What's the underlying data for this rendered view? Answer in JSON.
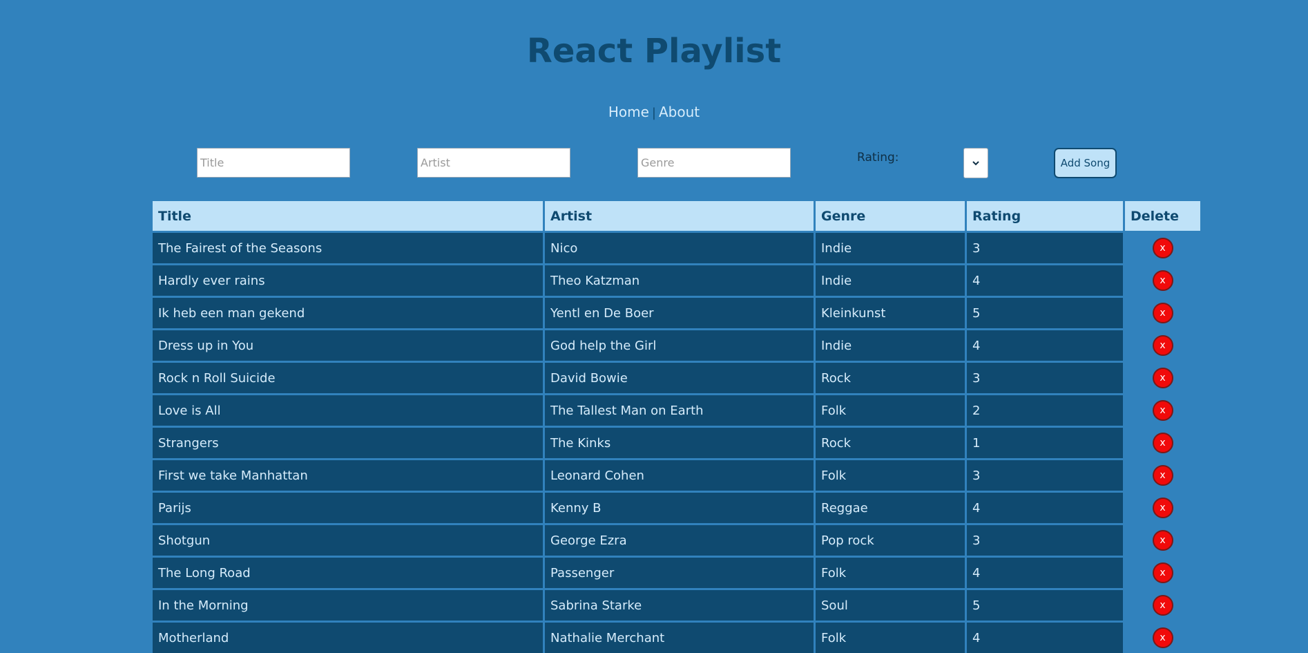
{
  "header": {
    "title": "React Playlist"
  },
  "nav": {
    "items": [
      {
        "label": "Home"
      },
      {
        "label": "About"
      }
    ],
    "separator": "|"
  },
  "form": {
    "title_placeholder": "Title",
    "artist_placeholder": "Artist",
    "genre_placeholder": "Genre",
    "rating_label": "Rating:",
    "rating_selected": "",
    "add_button_label": "Add Song"
  },
  "table": {
    "columns": [
      "Title",
      "Artist",
      "Genre",
      "Rating",
      "Delete"
    ],
    "delete_label": "x",
    "rows": [
      {
        "title": "The Fairest of the Seasons",
        "artist": "Nico",
        "genre": "Indie",
        "rating": "3"
      },
      {
        "title": "Hardly ever rains",
        "artist": "Theo Katzman",
        "genre": "Indie",
        "rating": "4"
      },
      {
        "title": "Ik heb een man gekend",
        "artist": "Yentl en De Boer",
        "genre": "Kleinkunst",
        "rating": "5"
      },
      {
        "title": "Dress up in You",
        "artist": "God help the Girl",
        "genre": "Indie",
        "rating": "4"
      },
      {
        "title": "Rock n Roll Suicide",
        "artist": "David Bowie",
        "genre": "Rock",
        "rating": "3"
      },
      {
        "title": "Love is All",
        "artist": "The Tallest Man on Earth",
        "genre": "Folk",
        "rating": "2"
      },
      {
        "title": "Strangers",
        "artist": "The Kinks",
        "genre": "Rock",
        "rating": "1"
      },
      {
        "title": "First we take Manhattan",
        "artist": "Leonard Cohen",
        "genre": "Folk",
        "rating": "3"
      },
      {
        "title": "Parijs",
        "artist": "Kenny B",
        "genre": "Reggae",
        "rating": "4"
      },
      {
        "title": "Shotgun",
        "artist": "George Ezra",
        "genre": "Pop rock",
        "rating": "3"
      },
      {
        "title": "The Long Road",
        "artist": "Passenger",
        "genre": "Folk",
        "rating": "4"
      },
      {
        "title": "In the Morning",
        "artist": "Sabrina Starke",
        "genre": "Soul",
        "rating": "5"
      },
      {
        "title": "Motherland",
        "artist": "Nathalie Merchant",
        "genre": "Folk",
        "rating": "4"
      }
    ]
  },
  "colors": {
    "background": "#3182bd",
    "title": "#0f4a70",
    "header_cell": "#bfe2f8",
    "body_cell": "#0f4a70",
    "body_text": "#d6ecfb",
    "delete_button": "#f10a0a"
  }
}
